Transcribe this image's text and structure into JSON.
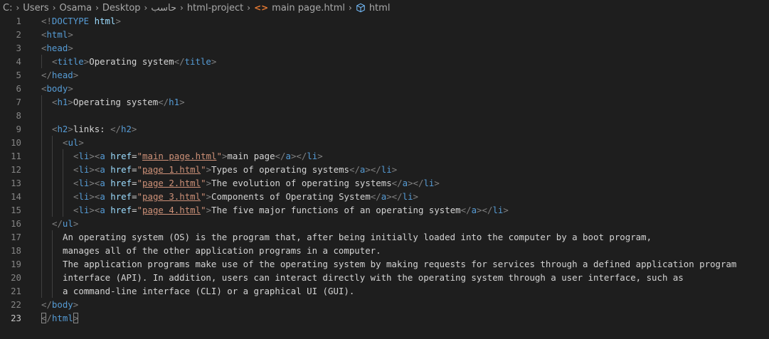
{
  "breadcrumb": {
    "items": [
      "C:",
      "Users",
      "Osama",
      "Desktop",
      "حاسب",
      "html-project",
      "main page.html",
      "html"
    ],
    "file_icon": "html-file-icon",
    "symbol_icon": "cube-icon"
  },
  "editor": {
    "language": "html",
    "lines": [
      {
        "num": "1",
        "indent": 0,
        "tokens": [
          {
            "t": "br",
            "v": "<!"
          },
          {
            "t": "tag",
            "v": "DOCTYPE"
          },
          {
            "t": "txt",
            "v": " "
          },
          {
            "t": "attr",
            "v": "html"
          },
          {
            "t": "br",
            "v": ">"
          }
        ]
      },
      {
        "num": "2",
        "indent": 0,
        "tokens": [
          {
            "t": "br",
            "v": "<"
          },
          {
            "t": "tag",
            "v": "html"
          },
          {
            "t": "br",
            "v": ">"
          }
        ]
      },
      {
        "num": "3",
        "indent": 0,
        "tokens": [
          {
            "t": "br",
            "v": "<"
          },
          {
            "t": "tag",
            "v": "head"
          },
          {
            "t": "br",
            "v": ">"
          }
        ]
      },
      {
        "num": "4",
        "indent": 1,
        "tokens": [
          {
            "t": "br",
            "v": "<"
          },
          {
            "t": "tag",
            "v": "title"
          },
          {
            "t": "br",
            "v": ">"
          },
          {
            "t": "txt",
            "v": "Operating system"
          },
          {
            "t": "br",
            "v": "</"
          },
          {
            "t": "tag",
            "v": "title"
          },
          {
            "t": "br",
            "v": ">"
          }
        ]
      },
      {
        "num": "5",
        "indent": 0,
        "tokens": [
          {
            "t": "br",
            "v": "</"
          },
          {
            "t": "tag",
            "v": "head"
          },
          {
            "t": "br",
            "v": ">"
          }
        ]
      },
      {
        "num": "6",
        "indent": 0,
        "tokens": [
          {
            "t": "br",
            "v": "<"
          },
          {
            "t": "tag",
            "v": "body"
          },
          {
            "t": "br",
            "v": ">"
          }
        ]
      },
      {
        "num": "7",
        "indent": 1,
        "tokens": [
          {
            "t": "br",
            "v": "<"
          },
          {
            "t": "tag",
            "v": "h1"
          },
          {
            "t": "br",
            "v": ">"
          },
          {
            "t": "txt",
            "v": "Operating system"
          },
          {
            "t": "br",
            "v": "</"
          },
          {
            "t": "tag",
            "v": "h1"
          },
          {
            "t": "br",
            "v": ">"
          }
        ]
      },
      {
        "num": "8",
        "indent": 1,
        "tokens": []
      },
      {
        "num": "9",
        "indent": 1,
        "tokens": [
          {
            "t": "br",
            "v": "<"
          },
          {
            "t": "tag",
            "v": "h2"
          },
          {
            "t": "br",
            "v": ">"
          },
          {
            "t": "txt",
            "v": "links: "
          },
          {
            "t": "br",
            "v": "</"
          },
          {
            "t": "tag",
            "v": "h2"
          },
          {
            "t": "br",
            "v": ">"
          }
        ]
      },
      {
        "num": "10",
        "indent": 2,
        "tokens": [
          {
            "t": "br",
            "v": "<"
          },
          {
            "t": "tag",
            "v": "ul"
          },
          {
            "t": "br",
            "v": ">"
          }
        ]
      },
      {
        "num": "11",
        "indent": 3,
        "tokens": [
          {
            "t": "br",
            "v": "<"
          },
          {
            "t": "tag",
            "v": "li"
          },
          {
            "t": "br",
            "v": "><"
          },
          {
            "t": "tag",
            "v": "a"
          },
          {
            "t": "txt",
            "v": " "
          },
          {
            "t": "attr",
            "v": "href"
          },
          {
            "t": "txt",
            "v": "="
          },
          {
            "t": "str",
            "v": "\""
          },
          {
            "t": "link",
            "v": "main page.html"
          },
          {
            "t": "str",
            "v": "\""
          },
          {
            "t": "br",
            "v": ">"
          },
          {
            "t": "txt",
            "v": "main page"
          },
          {
            "t": "br",
            "v": "</"
          },
          {
            "t": "tag",
            "v": "a"
          },
          {
            "t": "br",
            "v": "></"
          },
          {
            "t": "tag",
            "v": "li"
          },
          {
            "t": "br",
            "v": ">"
          }
        ]
      },
      {
        "num": "12",
        "indent": 3,
        "tokens": [
          {
            "t": "br",
            "v": "<"
          },
          {
            "t": "tag",
            "v": "li"
          },
          {
            "t": "br",
            "v": "><"
          },
          {
            "t": "tag",
            "v": "a"
          },
          {
            "t": "txt",
            "v": " "
          },
          {
            "t": "attr",
            "v": "href"
          },
          {
            "t": "txt",
            "v": "="
          },
          {
            "t": "str",
            "v": "\""
          },
          {
            "t": "link",
            "v": "page 1.html"
          },
          {
            "t": "str",
            "v": "\""
          },
          {
            "t": "br",
            "v": ">"
          },
          {
            "t": "txt",
            "v": "Types of operating systems"
          },
          {
            "t": "br",
            "v": "</"
          },
          {
            "t": "tag",
            "v": "a"
          },
          {
            "t": "br",
            "v": "></"
          },
          {
            "t": "tag",
            "v": "li"
          },
          {
            "t": "br",
            "v": ">"
          }
        ]
      },
      {
        "num": "13",
        "indent": 3,
        "tokens": [
          {
            "t": "br",
            "v": "<"
          },
          {
            "t": "tag",
            "v": "li"
          },
          {
            "t": "br",
            "v": "><"
          },
          {
            "t": "tag",
            "v": "a"
          },
          {
            "t": "txt",
            "v": " "
          },
          {
            "t": "attr",
            "v": "href"
          },
          {
            "t": "txt",
            "v": "="
          },
          {
            "t": "str",
            "v": "\""
          },
          {
            "t": "link",
            "v": "page 2.html"
          },
          {
            "t": "str",
            "v": "\""
          },
          {
            "t": "br",
            "v": ">"
          },
          {
            "t": "txt",
            "v": "The evolution of operating systems"
          },
          {
            "t": "br",
            "v": "</"
          },
          {
            "t": "tag",
            "v": "a"
          },
          {
            "t": "br",
            "v": "></"
          },
          {
            "t": "tag",
            "v": "li"
          },
          {
            "t": "br",
            "v": ">"
          }
        ]
      },
      {
        "num": "14",
        "indent": 3,
        "tokens": [
          {
            "t": "br",
            "v": "<"
          },
          {
            "t": "tag",
            "v": "li"
          },
          {
            "t": "br",
            "v": "><"
          },
          {
            "t": "tag",
            "v": "a"
          },
          {
            "t": "txt",
            "v": " "
          },
          {
            "t": "attr",
            "v": "href"
          },
          {
            "t": "txt",
            "v": "="
          },
          {
            "t": "str",
            "v": "\""
          },
          {
            "t": "link",
            "v": "page 3.html"
          },
          {
            "t": "str",
            "v": "\""
          },
          {
            "t": "br",
            "v": ">"
          },
          {
            "t": "txt",
            "v": "Components of Operating System"
          },
          {
            "t": "br",
            "v": "</"
          },
          {
            "t": "tag",
            "v": "a"
          },
          {
            "t": "br",
            "v": "></"
          },
          {
            "t": "tag",
            "v": "li"
          },
          {
            "t": "br",
            "v": ">"
          }
        ]
      },
      {
        "num": "15",
        "indent": 3,
        "tokens": [
          {
            "t": "br",
            "v": "<"
          },
          {
            "t": "tag",
            "v": "li"
          },
          {
            "t": "br",
            "v": "><"
          },
          {
            "t": "tag",
            "v": "a"
          },
          {
            "t": "txt",
            "v": " "
          },
          {
            "t": "attr",
            "v": "href"
          },
          {
            "t": "txt",
            "v": "="
          },
          {
            "t": "str",
            "v": "\""
          },
          {
            "t": "link",
            "v": "page 4.html"
          },
          {
            "t": "str",
            "v": "\""
          },
          {
            "t": "br",
            "v": ">"
          },
          {
            "t": "txt",
            "v": "The five major functions of an operating system"
          },
          {
            "t": "br",
            "v": "</"
          },
          {
            "t": "tag",
            "v": "a"
          },
          {
            "t": "br",
            "v": "></"
          },
          {
            "t": "tag",
            "v": "li"
          },
          {
            "t": "br",
            "v": ">"
          }
        ]
      },
      {
        "num": "16",
        "indent": 1,
        "tokens": [
          {
            "t": "br",
            "v": "</"
          },
          {
            "t": "tag",
            "v": "ul"
          },
          {
            "t": "br",
            "v": ">"
          }
        ]
      },
      {
        "num": "17",
        "indent": 2,
        "tokens": [
          {
            "t": "txt",
            "v": "An operating system (OS) is the program that, after being initially loaded into the computer by a boot program,"
          }
        ]
      },
      {
        "num": "18",
        "indent": 2,
        "tokens": [
          {
            "t": "txt",
            "v": "manages all of the other application programs in a computer."
          }
        ]
      },
      {
        "num": "19",
        "indent": 2,
        "tokens": [
          {
            "t": "txt",
            "v": "The application programs make use of the operating system by making requests for services through a defined application program"
          }
        ]
      },
      {
        "num": "20",
        "indent": 2,
        "tokens": [
          {
            "t": "txt",
            "v": "interface (API). In addition, users can interact directly with the operating system through a user interface, such as"
          }
        ]
      },
      {
        "num": "21",
        "indent": 2,
        "tokens": [
          {
            "t": "txt",
            "v": "a command-line interface (CLI) or a graphical UI (GUI)."
          }
        ]
      },
      {
        "num": "22",
        "indent": 0,
        "tokens": [
          {
            "t": "br",
            "v": "</"
          },
          {
            "t": "tag",
            "v": "body"
          },
          {
            "t": "br",
            "v": ">"
          }
        ]
      },
      {
        "num": "23",
        "indent": 0,
        "active": true,
        "tokens": [
          {
            "t": "brhl",
            "v": "<"
          },
          {
            "t": "br",
            "v": "/"
          },
          {
            "t": "tag",
            "v": "html"
          },
          {
            "t": "brhl",
            "v": ">"
          }
        ]
      }
    ]
  },
  "colors": {
    "background": "#1e1e1e",
    "tag": "#569cd6",
    "bracket": "#808080",
    "attribute": "#9cdcfe",
    "string": "#ce9178",
    "text": "#d4d4d4",
    "line_number": "#858585"
  }
}
